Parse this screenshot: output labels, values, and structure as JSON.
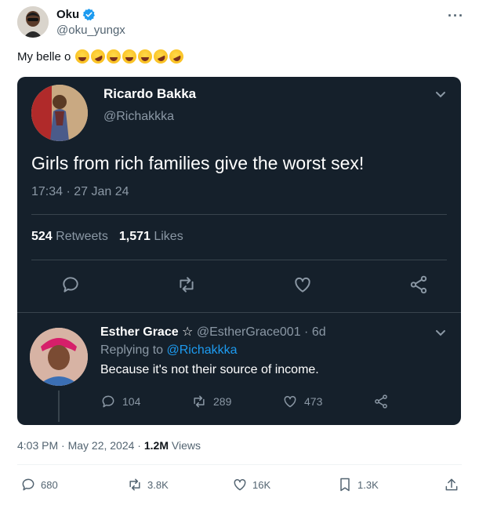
{
  "author": {
    "name": "Oku",
    "handle": "@oku_yungx"
  },
  "tweet": {
    "text": "My belle o",
    "emojis": [
      "joy",
      "rofl",
      "joy",
      "joy",
      "joy",
      "rofl",
      "rofl"
    ],
    "timestamp": "4:03 PM · May 22, 2024 · ",
    "views_count": "1.2M",
    "views_label": " Views"
  },
  "embedded": {
    "name": "Ricardo Bakka",
    "handle": "@Richakkka",
    "text": "Girls from rich families give the worst sex!",
    "time": "17:34 · 27 Jan 24",
    "retweets_count": "524",
    "retweets_label": " Retweets",
    "likes_count": "1,571",
    "likes_label": " Likes"
  },
  "reply": {
    "name": "Esther Grace ☆",
    "handle": " @EstherGrace001 · 6d",
    "replying_prefix": "Replying to ",
    "replying_handle": "@Richakkka",
    "text": "Because it's not their source of income.",
    "replies": "104",
    "retweets": "289",
    "likes": "473"
  },
  "actions": {
    "replies": "680",
    "reposts": "3.8K",
    "likes": "16K",
    "bookmarks": "1.3K"
  },
  "colors": {
    "verified": "#1d9bf0",
    "embed_bg": "#15202b",
    "link": "#1d9bf0"
  }
}
